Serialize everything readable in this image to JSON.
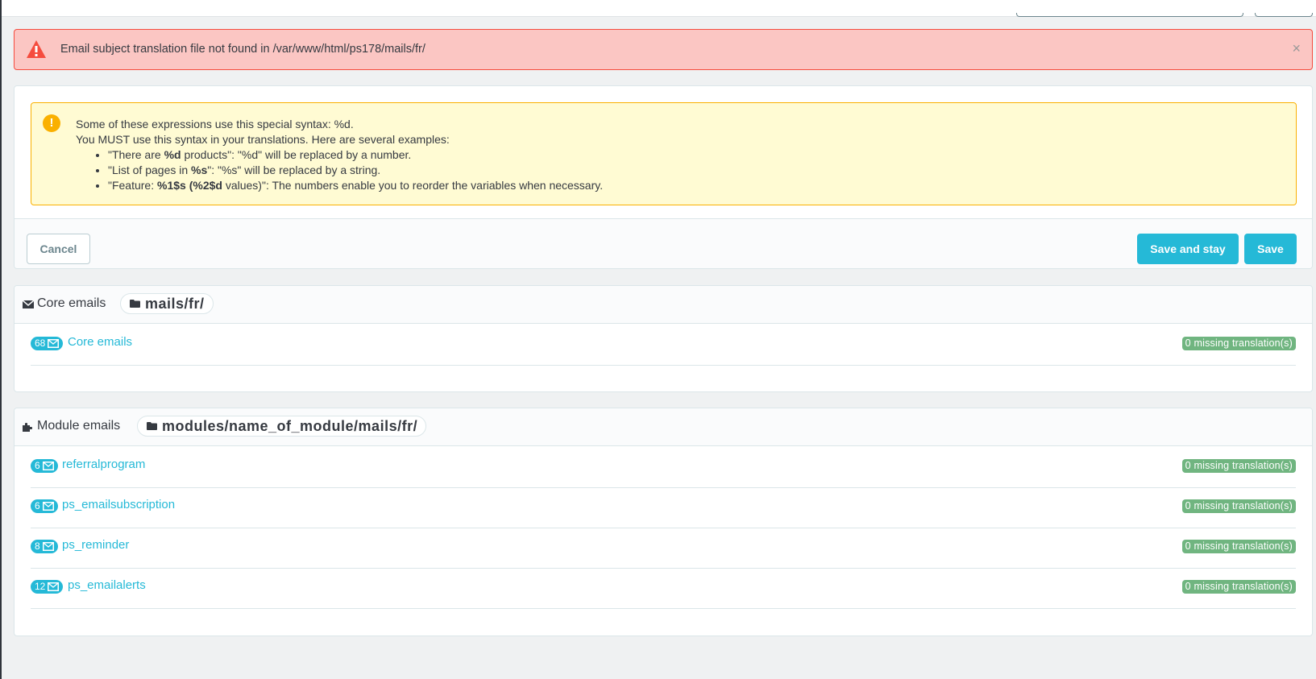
{
  "alert_error": {
    "message": "Email subject translation file not found in /var/www/html/ps178/mails/fr/",
    "close_label": "×"
  },
  "alert_warning": {
    "icon": "!",
    "line1": "Some of these expressions use this special syntax: %d.",
    "line2": "You MUST use this syntax in your translations. Here are several examples:",
    "examples": [
      {
        "pre": "\"There are ",
        "bold": "%d",
        "post": " products\": \"%d\" will be replaced by a number."
      },
      {
        "pre": "\"List of pages in ",
        "bold": "%s",
        "post": "\": \"%s\" will be replaced by a string."
      },
      {
        "pre": "\"Feature: ",
        "bold": "%1$s",
        "mid": " (",
        "bold2": "%2$d",
        "post": " values)\": The numbers enable you to reorder the variables when necessary."
      }
    ]
  },
  "footer": {
    "cancel_label": "Cancel",
    "save_stay_label": "Save and stay",
    "save_label": "Save"
  },
  "core_emails": {
    "title": "Core emails",
    "path": "mails/fr/",
    "items": [
      {
        "count": "68",
        "name": "Core emails",
        "missing": "0 missing translation(s)"
      }
    ]
  },
  "module_emails": {
    "title": "Module emails",
    "path": "modules/name_of_module/mails/fr/",
    "items": [
      {
        "count": "6",
        "name": "referralprogram",
        "missing": "0 missing translation(s)"
      },
      {
        "count": "6",
        "name": "ps_emailsubscription",
        "missing": "0 missing translation(s)"
      },
      {
        "count": "8",
        "name": "ps_reminder",
        "missing": "0 missing translation(s)"
      },
      {
        "count": "12",
        "name": "ps_emailalerts",
        "missing": "0 missing translation(s)"
      }
    ]
  },
  "icons": {
    "error": "warning-triangle-icon",
    "warning": "exclamation-circle-icon",
    "core_heading": "envelope-icon",
    "module_heading": "puzzle-icon",
    "path": "folder-icon",
    "count": "envelope-outline-icon"
  },
  "colors": {
    "primary": "#25b9d7",
    "danger_bg": "#fbc6c3",
    "danger_border": "#f54c3e",
    "warning_bg": "#fffbd3",
    "warning_border": "#fab000",
    "success": "#70b580"
  }
}
